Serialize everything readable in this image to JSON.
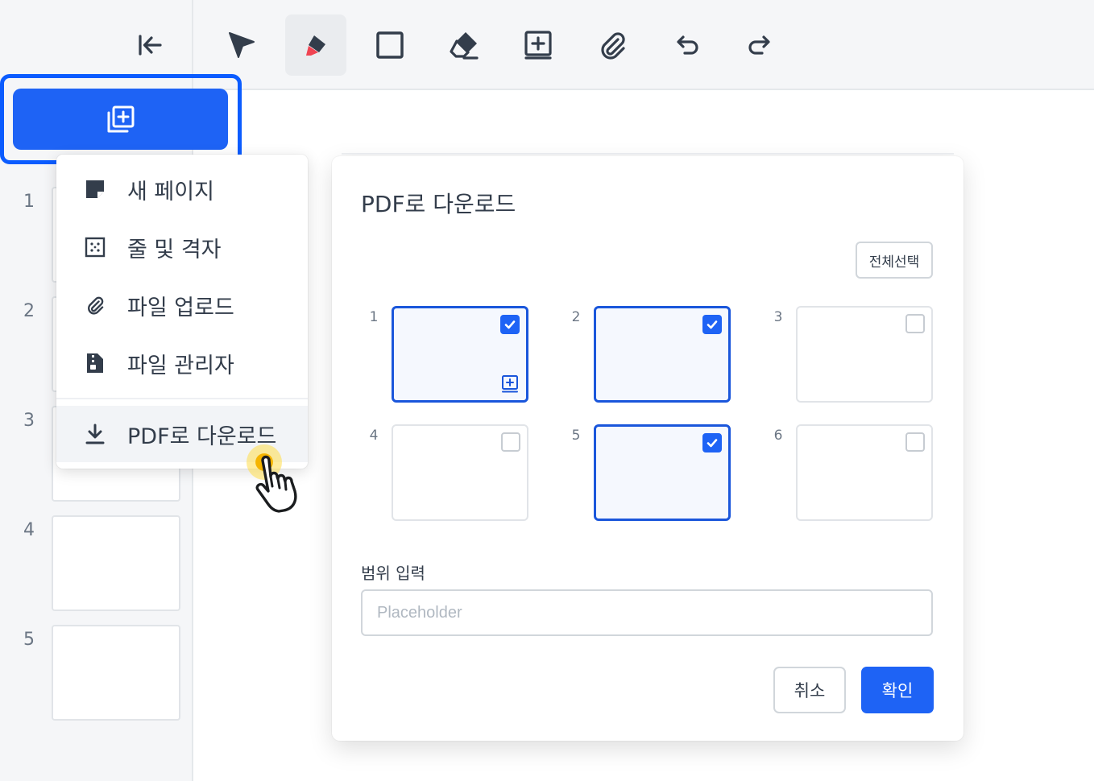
{
  "colors": {
    "accent": "#1e63f5",
    "highlight_border": "#0b5cff",
    "selected_border": "#1a56db",
    "sidebar_bg": "#f5f6f8",
    "cursor_dot": "#f5b400"
  },
  "toolbar": {
    "tools": [
      {
        "name": "select-arrow-icon",
        "active": false
      },
      {
        "name": "pen-icon",
        "active": true
      },
      {
        "name": "rectangle-icon",
        "active": false
      },
      {
        "name": "eraser-icon",
        "active": false
      },
      {
        "name": "add-box-icon",
        "active": false
      },
      {
        "name": "paperclip-icon",
        "active": false
      },
      {
        "name": "undo-icon",
        "active": false
      },
      {
        "name": "redo-icon",
        "active": false
      }
    ]
  },
  "sidebar": {
    "collapse_icon": "collapse-left-icon",
    "add_button_icon": "add-page-icon",
    "pages": [
      "1",
      "2",
      "3",
      "4",
      "5"
    ]
  },
  "menu": {
    "items": [
      {
        "label": "새 페이지",
        "icon": "note-icon"
      },
      {
        "label": "줄 및 격자",
        "icon": "grid-icon"
      },
      {
        "label": "파일 업로드",
        "icon": "paperclip-icon"
      },
      {
        "label": "파일 관리자",
        "icon": "zip-file-icon"
      },
      {
        "label": "PDF로 다운로드",
        "icon": "download-icon"
      }
    ],
    "hovered_index": 4
  },
  "dialog": {
    "title": "PDF로 다운로드",
    "select_all": "전체선택",
    "pages": [
      {
        "number": "1",
        "checked": true
      },
      {
        "number": "2",
        "checked": true
      },
      {
        "number": "3",
        "checked": false
      },
      {
        "number": "4",
        "checked": false
      },
      {
        "number": "5",
        "checked": true
      },
      {
        "number": "6",
        "checked": false
      }
    ],
    "range_label": "범위 입력",
    "range_placeholder": "Placeholder",
    "range_value": "",
    "cancel": "취소",
    "confirm": "확인"
  }
}
